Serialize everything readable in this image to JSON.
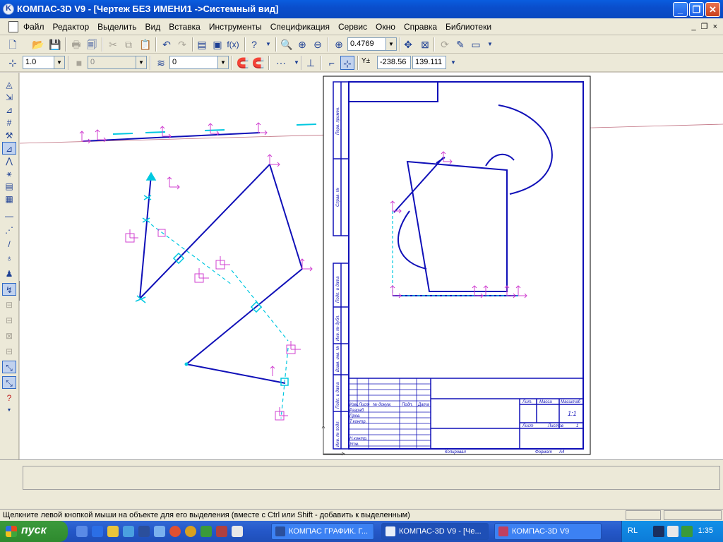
{
  "window": {
    "title": "КОМПАС-3D V9 - [Чертеж БЕЗ ИМЕНИ1 ->Системный вид]",
    "minimize": "_",
    "restore": "❐",
    "close": "✕"
  },
  "menu": {
    "items": [
      "Файл",
      "Редактор",
      "Выделить",
      "Вид",
      "Вставка",
      "Инструменты",
      "Спецификация",
      "Сервис",
      "Окно",
      "Справка",
      "Библиотеки"
    ],
    "mdi_controls": "_ ❐ ×"
  },
  "toolbar1": {
    "zoom_value": "0.4769"
  },
  "toolbar2": {
    "step_value": "1.0",
    "layer_value": "0",
    "style_value": "0",
    "coord_label": "Y±",
    "coord_x": "-238.56",
    "coord_y": "139.111"
  },
  "flyout": {
    "label": "/=\\"
  },
  "drawing": {
    "stamp": {
      "izm": "Изм.",
      "list": "Лист",
      "ndokum": "№ докум.",
      "podp": "Подп.",
      "data": "Дата",
      "razrab": "Разраб.",
      "prov": "Пров.",
      "tkontr": "Т.контр.",
      "nkontr": "Н.контр.",
      "utv": "Утв.",
      "lit": "Лит.",
      "massa": "Масса",
      "masshtab": "Масштаб",
      "scale_value": "1:1",
      "list2": "Лист",
      "listov": "Листов",
      "listov_value": "1",
      "kopiroval": "Копировал",
      "format": "Формат",
      "format_value": "A4"
    },
    "side_labels": [
      "Перв. примен.",
      "Справ. №",
      "Подп. и дата",
      "Инв. № дубл.",
      "Взам. инв. №",
      "Подп. и дата",
      "Инв. № подл."
    ]
  },
  "status": {
    "message": "Щелкните левой кнопкой мыши на объекте для его выделения (вместе с Ctrl или Shift - добавить к выделенным)"
  },
  "taskbar": {
    "start": "пуск",
    "tasks": [
      "КОМПАС ГРАФИК. Г...",
      "КОМПАС-3D V9 - [Че...",
      "КОМПАС-3D V9"
    ],
    "lang": "RL",
    "clock": "1:35"
  }
}
